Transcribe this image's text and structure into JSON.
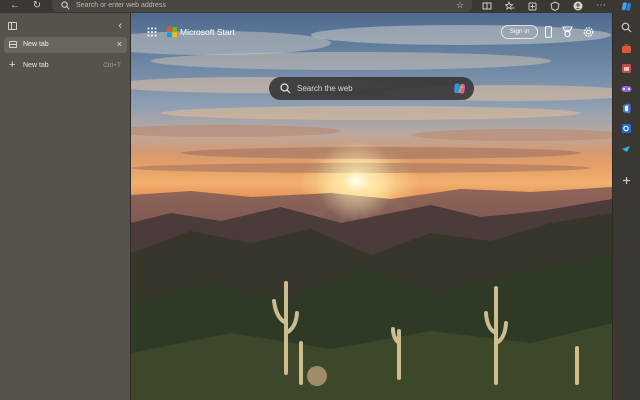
{
  "addressbar": {
    "placeholder": "Search or enter web address",
    "back_icon": "back-arrow-icon",
    "refresh_icon": "refresh-icon",
    "favorite_icon": "star-icon"
  },
  "toolbar_icons": [
    "split-screen-icon",
    "favorites-icon",
    "collections-icon",
    "browser-essentials-icon",
    "profile-icon",
    "more-icon"
  ],
  "tabs_pane": {
    "collapse_icon": "chevron-left-icon",
    "tabs": [
      {
        "label": "New tab"
      }
    ],
    "new_tab": {
      "label": "New tab",
      "shortcut": "Ctrl+T"
    }
  },
  "page": {
    "brand": "Microsoft Start",
    "signin_label": "Sign in",
    "search_placeholder": "Search the web",
    "colors": {
      "accent_red": "#f25022",
      "accent_green": "#7fba00",
      "accent_blue": "#00a4ef",
      "accent_yellow": "#ffb900"
    }
  },
  "right_sidebar": {
    "icons": [
      "copilot-icon",
      "search-icon",
      "shopping-icon",
      "tools-icon",
      "games-icon",
      "office-icon",
      "outlook-icon",
      "drop-icon",
      "add-icon"
    ]
  }
}
